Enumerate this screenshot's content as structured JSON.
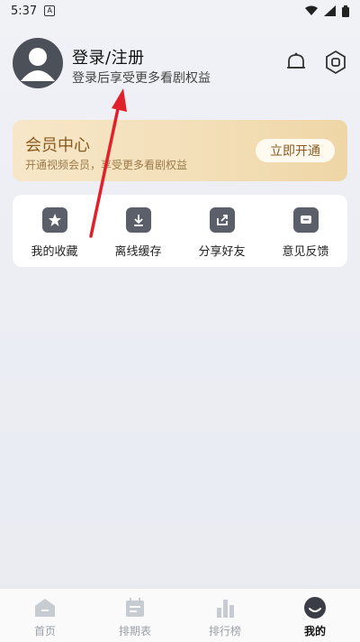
{
  "status_bar": {
    "time": "5:37",
    "sim_label": "A"
  },
  "profile": {
    "title": "登录/注册",
    "subtitle": "登录后享受更多看剧权益"
  },
  "vip_card": {
    "title": "会员中心",
    "subtitle": "开通视频会员，享受更多看剧权益",
    "button": "立即开通"
  },
  "actions": [
    {
      "label": "我的收藏",
      "icon": "star-icon"
    },
    {
      "label": "离线缓存",
      "icon": "download-icon"
    },
    {
      "label": "分享好友",
      "icon": "share-icon"
    },
    {
      "label": "意见反馈",
      "icon": "feedback-icon"
    }
  ],
  "bottom_nav": [
    {
      "label": "首页",
      "icon": "home-icon"
    },
    {
      "label": "排期表",
      "icon": "calendar-icon"
    },
    {
      "label": "排行榜",
      "icon": "ranking-icon"
    },
    {
      "label": "我的",
      "icon": "profile-icon",
      "active": true
    }
  ],
  "colors": {
    "vip_text": "#8a5b1e",
    "annotation_arrow": "#e0202a",
    "icon_gray": "#5b5f69"
  }
}
